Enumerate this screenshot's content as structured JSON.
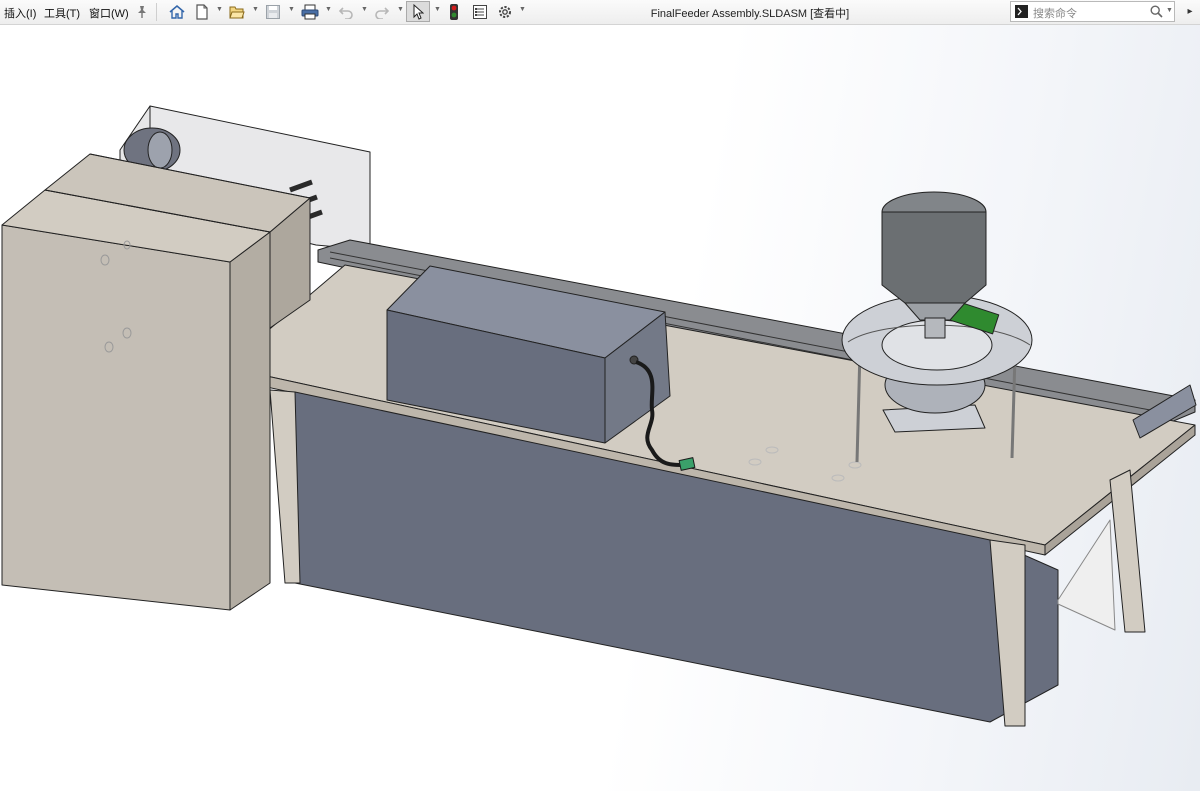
{
  "menu": {
    "insert": "插入(I)",
    "tools": "工具(T)",
    "window": "窗口(W)"
  },
  "toolbar": {
    "icons": [
      "home-icon",
      "new-file-icon",
      "open-icon",
      "save-icon",
      "print-icon",
      "undo-icon",
      "redo-icon",
      "select-icon",
      "rebuild-icon",
      "file-properties-icon",
      "options-icon"
    ]
  },
  "window_title": "FinalFeeder Assembly.SLDASM [查看中]",
  "search": {
    "placeholder": "搜索命令"
  },
  "headsup": {
    "icons": [
      "zoom-to-fit-icon",
      "zoom-to-area-icon",
      "previous-view-icon",
      "section-view-icon",
      "view-orientation-icon",
      "display-style-icon",
      "hide-show-icon",
      "edit-appearance-icon",
      "apply-scene-icon",
      "view-settings-icon"
    ]
  },
  "colors": {
    "cabinet": "#c4beb5",
    "panel": "#686e7e",
    "tabletop": "#d2ccc2",
    "hopper": "#6b6f72",
    "bowl": "#cdd0d6",
    "accent_green": "#2f8a2f",
    "accent_red": "#d21d1d"
  }
}
